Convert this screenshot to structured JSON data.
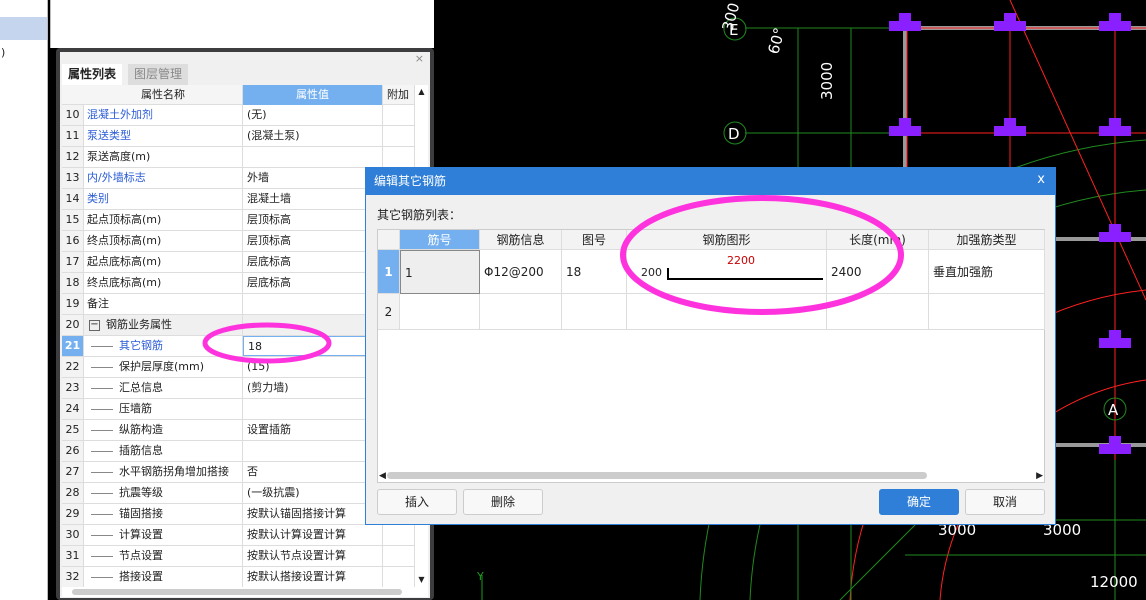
{
  "left_pane": {
    "fragment": ")"
  },
  "panel": {
    "close": "×",
    "tabs": [
      {
        "label": "属性列表",
        "active": true
      },
      {
        "label": "图层管理",
        "active": false
      }
    ],
    "headers": {
      "name": "属性名称",
      "value": "属性值",
      "extra": "附加"
    },
    "rows": [
      {
        "n": "10",
        "name": "混凝土外加剂",
        "value": "(无)",
        "blue": true,
        "indent": false
      },
      {
        "n": "11",
        "name": "泵送类型",
        "value": "(混凝土泵)",
        "blue": true,
        "indent": false
      },
      {
        "n": "12",
        "name": "泵送高度(m)",
        "value": "",
        "blue": false,
        "indent": false
      },
      {
        "n": "13",
        "name": "内/外墙标志",
        "value": "外墙",
        "blue": true,
        "indent": false
      },
      {
        "n": "14",
        "name": "类别",
        "value": "混凝土墙",
        "blue": true,
        "indent": false
      },
      {
        "n": "15",
        "name": "起点顶标高(m)",
        "value": "层顶标高",
        "blue": false,
        "indent": false
      },
      {
        "n": "16",
        "name": "终点顶标高(m)",
        "value": "层顶标高",
        "blue": false,
        "indent": false
      },
      {
        "n": "17",
        "name": "起点底标高(m)",
        "value": "层底标高",
        "blue": false,
        "indent": false
      },
      {
        "n": "18",
        "name": "终点底标高(m)",
        "value": "层底标高",
        "blue": false,
        "indent": false
      },
      {
        "n": "19",
        "name": "备注",
        "value": "",
        "blue": false,
        "indent": false
      },
      {
        "n": "20",
        "name": "钢筋业务属性",
        "value": "",
        "blue": false,
        "indent": false,
        "group": true
      },
      {
        "n": "21",
        "name": "其它钢筋",
        "value": "18",
        "blue": true,
        "indent": true,
        "selected": true
      },
      {
        "n": "22",
        "name": "保护层厚度(mm)",
        "value": "(15)",
        "blue": false,
        "indent": true
      },
      {
        "n": "23",
        "name": "汇总信息",
        "value": "(剪力墙)",
        "blue": false,
        "indent": true
      },
      {
        "n": "24",
        "name": "压墙筋",
        "value": "",
        "blue": false,
        "indent": true
      },
      {
        "n": "25",
        "name": "纵筋构造",
        "value": "设置插筋",
        "blue": false,
        "indent": true
      },
      {
        "n": "26",
        "name": "插筋信息",
        "value": "",
        "blue": false,
        "indent": true
      },
      {
        "n": "27",
        "name": "水平钢筋拐角增加搭接",
        "value": "否",
        "blue": false,
        "indent": true
      },
      {
        "n": "28",
        "name": "抗震等级",
        "value": "(一级抗震)",
        "blue": false,
        "indent": true
      },
      {
        "n": "29",
        "name": "锚固搭接",
        "value": "按默认锚固搭接计算",
        "blue": false,
        "indent": true
      },
      {
        "n": "30",
        "name": "计算设置",
        "value": "按默认计算设置计算",
        "blue": false,
        "indent": true
      },
      {
        "n": "31",
        "name": "节点设置",
        "value": "按默认节点设置计算",
        "blue": false,
        "indent": true
      },
      {
        "n": "32",
        "name": "搭接设置",
        "value": "按默认搭接设置计算",
        "blue": false,
        "indent": true
      }
    ]
  },
  "dialog": {
    "title": "编辑其它钢筋",
    "close": "x",
    "list_label": "其它钢筋列表：",
    "headers": [
      "筋号",
      "钢筋信息",
      "图号",
      "钢筋图形",
      "长度(mm)",
      "加强筋类型"
    ],
    "rows": [
      {
        "n": "1",
        "bar_no": "1",
        "info": "Φ12@200",
        "shape_no": "18",
        "shape_left": "200",
        "shape_top": "2200",
        "length": "2400",
        "type": "垂直加强筋"
      },
      {
        "n": "2",
        "bar_no": "",
        "info": "",
        "shape_no": "",
        "shape_left": "",
        "shape_top": "",
        "length": "",
        "type": ""
      }
    ],
    "buttons": {
      "insert": "插入",
      "delete": "删除",
      "ok": "确定",
      "cancel": "取消"
    }
  },
  "cad": {
    "labels": {
      "e": "E",
      "d": "D",
      "a": "A",
      "dim_3000_v": "3000",
      "angle_60": "60°",
      "dim_300": "300",
      "dim_3000_a": "3000",
      "dim_3000_b": "3000",
      "dim_12000": "12000",
      "y_axis": "Y"
    }
  },
  "colors": {
    "accent": "#2f7fd8",
    "highlight": "#ff33dd",
    "column": "#8a1fff",
    "axis": "#1f9a1f",
    "beam": "#ff2020"
  }
}
